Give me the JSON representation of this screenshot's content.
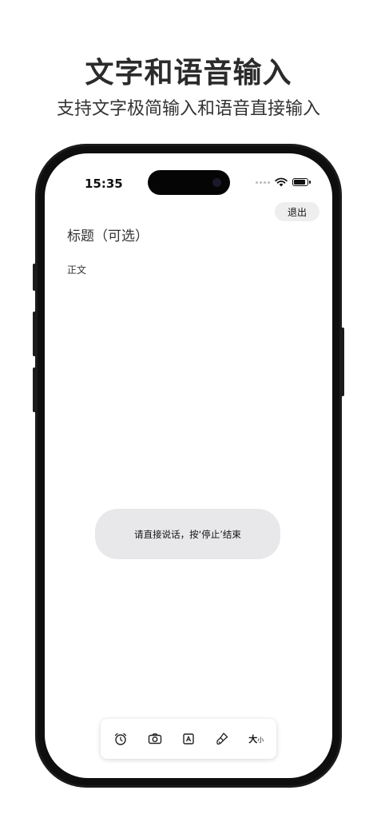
{
  "promo": {
    "headline": "文字和语音输入",
    "subheadline": "支持文字极简输入和语音直接输入"
  },
  "status_bar": {
    "time": "15:35"
  },
  "editor": {
    "exit_label": "退出",
    "title_placeholder": "标题（可选）",
    "body_placeholder": "正文"
  },
  "toast": {
    "message": "请直接说话，按‘停止’结束"
  },
  "toolbar": {
    "items": [
      {
        "icon": "alarm-clock-icon"
      },
      {
        "icon": "camera-icon"
      },
      {
        "icon": "text-format-icon"
      },
      {
        "icon": "brush-icon"
      },
      {
        "icon": "font-size-icon",
        "label_big": "大",
        "label_small": "小"
      }
    ]
  }
}
